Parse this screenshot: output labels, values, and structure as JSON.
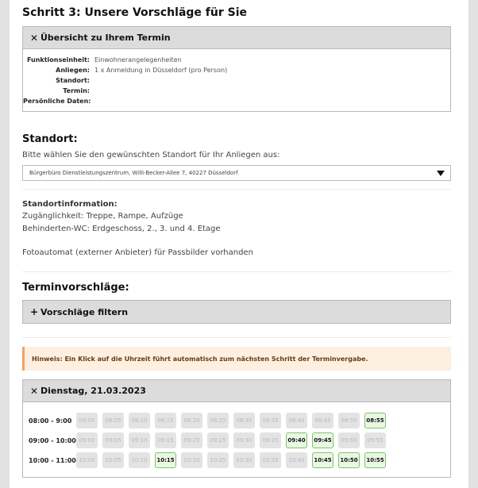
{
  "step_title": "Schritt 3: Unsere Vorschläge für Sie",
  "overview": {
    "title": "Übersicht zu Ihrem Termin",
    "rows": [
      {
        "label": "Funktionseinheit:",
        "value": "Einwohnerangelegenheiten"
      },
      {
        "label": "Anliegen:",
        "value": "1 x Anmeldung in Düsseldorf (pro Person)"
      },
      {
        "label": "Standort:",
        "value": ""
      },
      {
        "label": "Termin:",
        "value": ""
      },
      {
        "label": "Persönliche Daten:",
        "value": ""
      }
    ]
  },
  "location": {
    "heading": "Standort:",
    "prompt": "Bitte wählen Sie den gewünschten Standort für Ihr Anliegen aus:",
    "selected": "Bürgerbüro Dienstleistungszentrum, Willi-Becker-Allee 7, 40227 Düsseldorf",
    "info_title": "Standortinformation:",
    "info_lines": [
      "Zugänglichkeit: Treppe, Rampe, Aufzüge",
      "Behinderten-WC: Erdgeschoss, 2., 3. und 4. Etage",
      "Fotoautomat (externer Anbieter) für Passbilder vorhanden"
    ]
  },
  "suggestions": {
    "heading": "Terminvorschläge:",
    "filter_label": "Vorschläge filtern",
    "hint": "Hinweis: Ein Klick auf die Uhrzeit führt automatisch zum nächsten Schritt der Terminvergabe."
  },
  "day": {
    "title": "Dienstag, 21.03.2023",
    "rows": [
      {
        "hour": "08:00 - 9:00",
        "slots": [
          {
            "t": "08:00",
            "a": false
          },
          {
            "t": "08:05",
            "a": false
          },
          {
            "t": "08:10",
            "a": false
          },
          {
            "t": "08:15",
            "a": false
          },
          {
            "t": "08:20",
            "a": false
          },
          {
            "t": "08:25",
            "a": false
          },
          {
            "t": "08:30",
            "a": false
          },
          {
            "t": "08:35",
            "a": false
          },
          {
            "t": "08:40",
            "a": false
          },
          {
            "t": "08:45",
            "a": false
          },
          {
            "t": "08:50",
            "a": false
          },
          {
            "t": "08:55",
            "a": true
          }
        ]
      },
      {
        "hour": "09:00 - 10:00",
        "slots": [
          {
            "t": "09:00",
            "a": false
          },
          {
            "t": "09:05",
            "a": false
          },
          {
            "t": "09:10",
            "a": false
          },
          {
            "t": "09:15",
            "a": false
          },
          {
            "t": "09:20",
            "a": false
          },
          {
            "t": "09:25",
            "a": false
          },
          {
            "t": "09:30",
            "a": false
          },
          {
            "t": "09:35",
            "a": false
          },
          {
            "t": "09:40",
            "a": true
          },
          {
            "t": "09:45",
            "a": true
          },
          {
            "t": "09:50",
            "a": false
          },
          {
            "t": "09:55",
            "a": false
          }
        ]
      },
      {
        "hour": "10:00 - 11:00",
        "slots": [
          {
            "t": "10:00",
            "a": false
          },
          {
            "t": "10:05",
            "a": false
          },
          {
            "t": "10:10",
            "a": false
          },
          {
            "t": "10:15",
            "a": true
          },
          {
            "t": "10:20",
            "a": false
          },
          {
            "t": "10:25",
            "a": false
          },
          {
            "t": "10:30",
            "a": false
          },
          {
            "t": "10:35",
            "a": false
          },
          {
            "t": "10:40",
            "a": false
          },
          {
            "t": "10:45",
            "a": true
          },
          {
            "t": "10:50",
            "a": true
          },
          {
            "t": "10:55",
            "a": true
          }
        ]
      }
    ]
  },
  "icons": {
    "close": "✕",
    "plus": "+",
    "dropdown": "caret-down"
  }
}
